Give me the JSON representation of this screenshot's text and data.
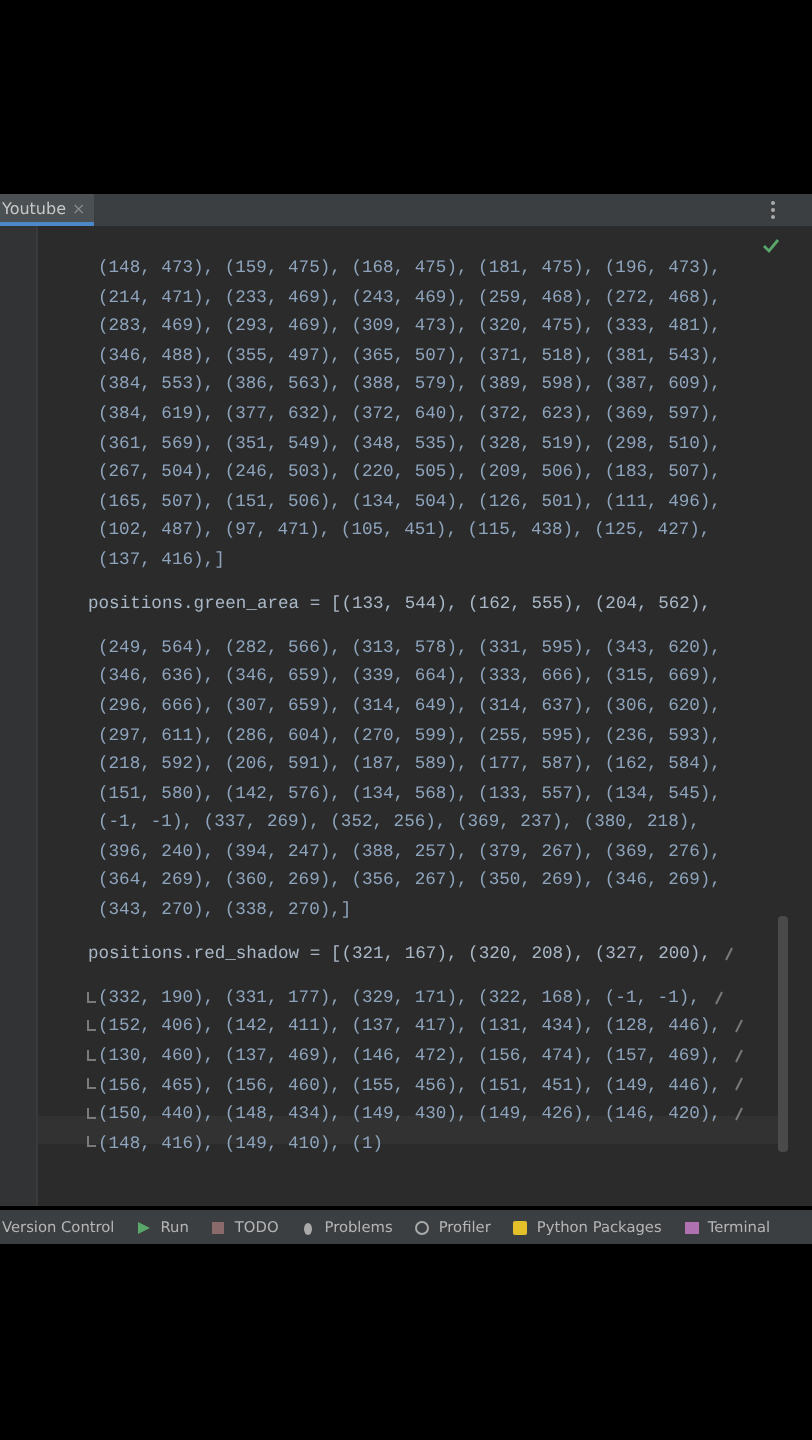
{
  "tab": {
    "label": "Youtube",
    "close": "×"
  },
  "lines": [
    {
      "kind": "code",
      "text": "(148, 473), (159, 475), (168, 475), (181, 475), (196, 473),"
    },
    {
      "kind": "code",
      "text": "(214, 471), (233, 469), (243, 469), (259, 468), (272, 468),"
    },
    {
      "kind": "code",
      "text": "(283, 469), (293, 469), (309, 473), (320, 475), (333, 481),"
    },
    {
      "kind": "code",
      "text": "(346, 488), (355, 497), (365, 507), (371, 518), (381, 543),"
    },
    {
      "kind": "code",
      "text": "(384, 553), (386, 563), (388, 579), (389, 598), (387, 609),"
    },
    {
      "kind": "code",
      "text": "(384, 619), (377, 632), (372, 640), (372, 623), (369, 597),"
    },
    {
      "kind": "code",
      "text": "(361, 569), (351, 549), (348, 535), (328, 519), (298, 510),"
    },
    {
      "kind": "code",
      "text": "(267, 504), (246, 503), (220, 505), (209, 506), (183, 507),"
    },
    {
      "kind": "code",
      "text": "(165, 507), (151, 506), (134, 504), (126, 501), (111, 496),"
    },
    {
      "kind": "code",
      "text": "(102, 487), (97, 471), (105, 451), (115, 438), (125, 427),"
    },
    {
      "kind": "code",
      "text": "(137, 416),]"
    },
    {
      "kind": "blank"
    },
    {
      "kind": "statement",
      "text": "positions.green_area = [(133, 544), (162, 555), (204, 562),"
    },
    {
      "kind": "code",
      "text": "(249, 564), (282, 566), (313, 578), (331, 595), (343, 620),"
    },
    {
      "kind": "code",
      "text": "(346, 636), (346, 659), (339, 664), (333, 666), (315, 669),"
    },
    {
      "kind": "code",
      "text": "(296, 666), (307, 659), (314, 649), (314, 637), (306, 620),"
    },
    {
      "kind": "code",
      "text": "(297, 611), (286, 604), (270, 599), (255, 595), (236, 593),"
    },
    {
      "kind": "code",
      "text": "(218, 592), (206, 591), (187, 589), (177, 587), (162, 584),"
    },
    {
      "kind": "code",
      "text": "(151, 580), (142, 576), (134, 568), (133, 557), (134, 545),"
    },
    {
      "kind": "code",
      "text": "(-1, -1), (337, 269), (352, 256), (369, 237), (380, 218),"
    },
    {
      "kind": "code",
      "text": "(396, 240), (394, 247), (388, 257), (379, 267), (369, 276),"
    },
    {
      "kind": "code",
      "text": "(364, 269), (360, 269), (356, 267), (350, 269), (346, 269),"
    },
    {
      "kind": "code",
      "text": "(343, 270), (338, 270),]"
    },
    {
      "kind": "blank"
    },
    {
      "kind": "statement",
      "text": "positions.red_shadow = [(321, 167), (320, 208), (327, 200),",
      "wrap_in": false,
      "wrap_out": true
    },
    {
      "kind": "code",
      "text": "(332, 190), (331, 177), (329, 171), (322, 168), (-1, -1),",
      "wrap_in": true,
      "wrap_out": true
    },
    {
      "kind": "code",
      "text": "(152, 406), (142, 411), (137, 417), (131, 434), (128, 446),",
      "wrap_in": true,
      "wrap_out": true
    },
    {
      "kind": "code",
      "text": "(130, 460), (137, 469), (146, 472), (156, 474), (157, 469),",
      "wrap_in": true,
      "wrap_out": true
    },
    {
      "kind": "code",
      "text": "(156, 465), (156, 460), (155, 456), (151, 451), (149, 446),",
      "wrap_in": true,
      "wrap_out": true
    },
    {
      "kind": "code",
      "text": "(150, 440), (148, 434), (149, 430), (149, 426), (146, 420),",
      "wrap_in": true,
      "wrap_out": true
    },
    {
      "kind": "code",
      "text": "(148, 416), (149, 410), (1)",
      "wrap_in": true,
      "wrap_out": false,
      "current": true
    }
  ],
  "toolbar": [
    {
      "kind": "vcs",
      "label": "Version Control"
    },
    {
      "kind": "run",
      "label": "Run"
    },
    {
      "kind": "todo",
      "label": "TODO"
    },
    {
      "kind": "problems",
      "label": "Problems"
    },
    {
      "kind": "profiler",
      "label": "Profiler"
    },
    {
      "kind": "packages",
      "label": "Python Packages"
    },
    {
      "kind": "terminal",
      "label": "Terminal"
    }
  ]
}
